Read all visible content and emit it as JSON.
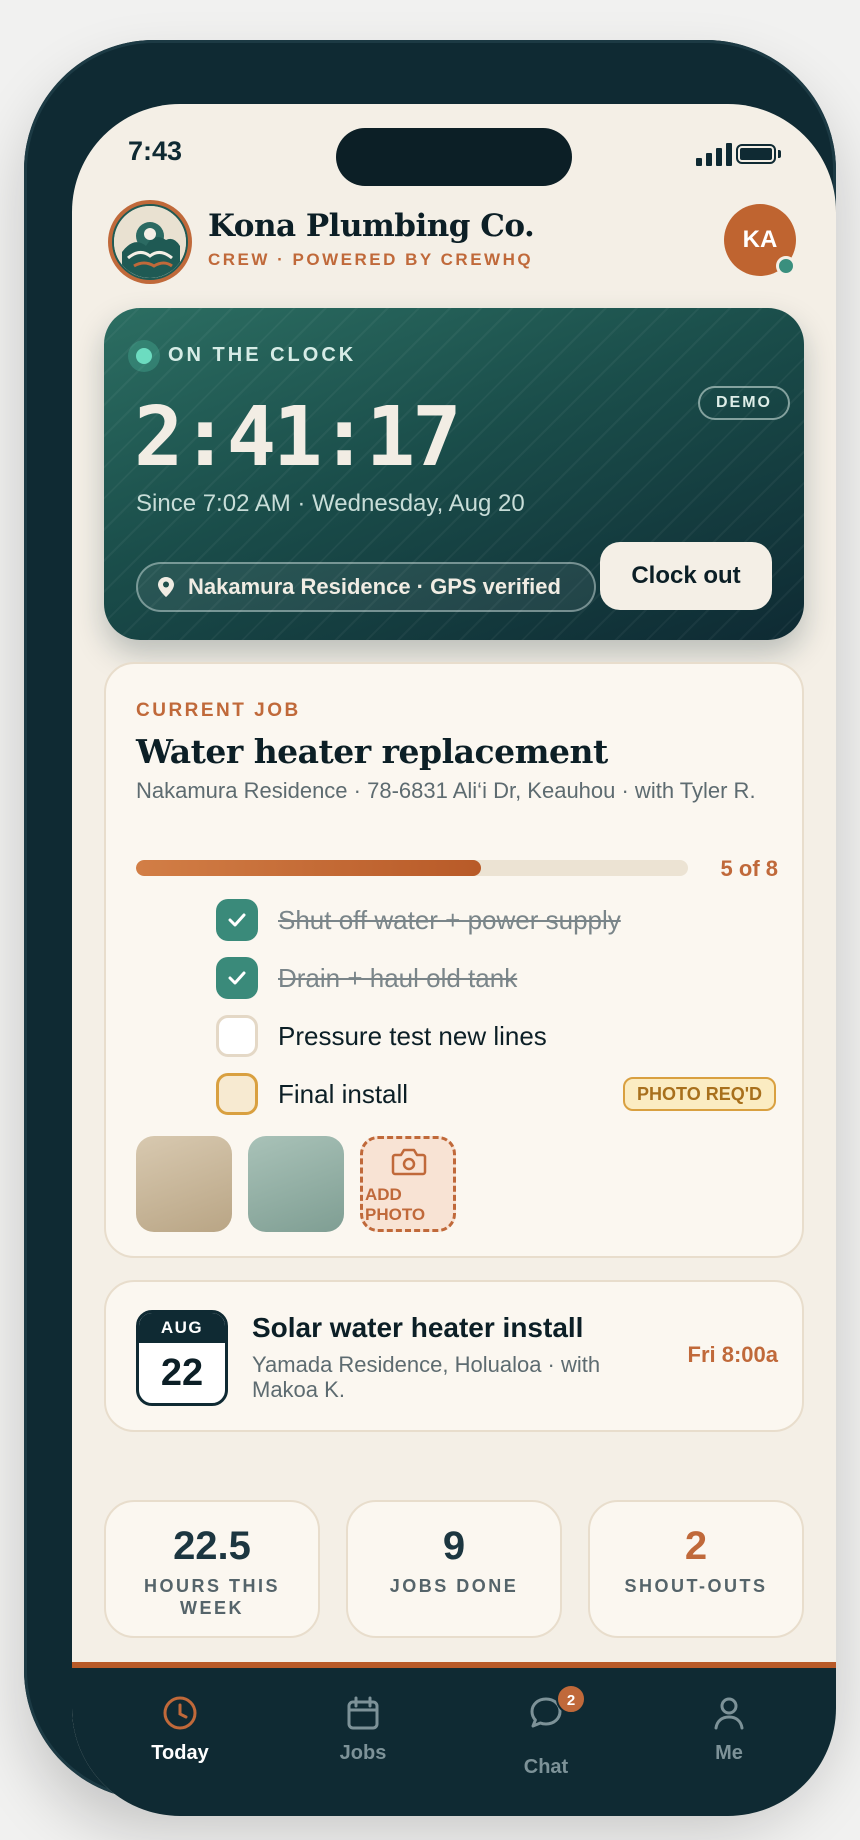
{
  "status_bar": {
    "time": "7:43"
  },
  "header": {
    "brand_name": "Kona Plumbing Co.",
    "brand_subtitle": "CREW · POWERED BY CREWHQ",
    "avatar_initials": "KA"
  },
  "clock": {
    "status_label": "ON THE CLOCK",
    "demo_label": "DEMO",
    "elapsed": "2:41:17",
    "since_text": "Since 7:02 AM · Wednesday, Aug 20",
    "location_text": "Nakamura Residence · GPS verified",
    "clock_out_label": "Clock out"
  },
  "current_job": {
    "eyebrow": "CURRENT JOB",
    "title": "Water heater replacement",
    "subtitle": "Nakamura Residence · 78-6831 Ali‘i Dr, Keauhou · with Tyler R.",
    "progress_text": "5 of 8",
    "progress_fraction": 0.625,
    "checklist": [
      {
        "label": "Shut off water + power supply",
        "state": "done"
      },
      {
        "label": "Drain + haul old tank",
        "state": "done"
      },
      {
        "label": "Pressure test new lines",
        "state": "open"
      },
      {
        "label": "Final install",
        "state": "pending",
        "badge": "PHOTO REQ'D"
      }
    ],
    "add_photo_label": "ADD PHOTO"
  },
  "next_job": {
    "month": "AUG",
    "day": "22",
    "title": "Solar water heater install",
    "subtitle": "Yamada Residence, Holualoa · with Makoa K.",
    "time": "Fri 8:00a"
  },
  "stats": [
    {
      "value": "22.5",
      "label": "HOURS THIS WEEK"
    },
    {
      "value": "9",
      "label": "JOBS DONE"
    },
    {
      "value": "2",
      "label": "SHOUT-OUTS"
    }
  ],
  "tabs": [
    {
      "label": "Today",
      "icon": "clock-icon",
      "active": true
    },
    {
      "label": "Jobs",
      "icon": "calendar-icon"
    },
    {
      "label": "Chat",
      "icon": "chat-icon",
      "badge": "2"
    },
    {
      "label": "Me",
      "icon": "person-icon"
    }
  ],
  "colors": {
    "accent": "#c0693a",
    "teal": "#3a8a7a",
    "navy": "#0f2a33",
    "background": "#f4efe6"
  }
}
